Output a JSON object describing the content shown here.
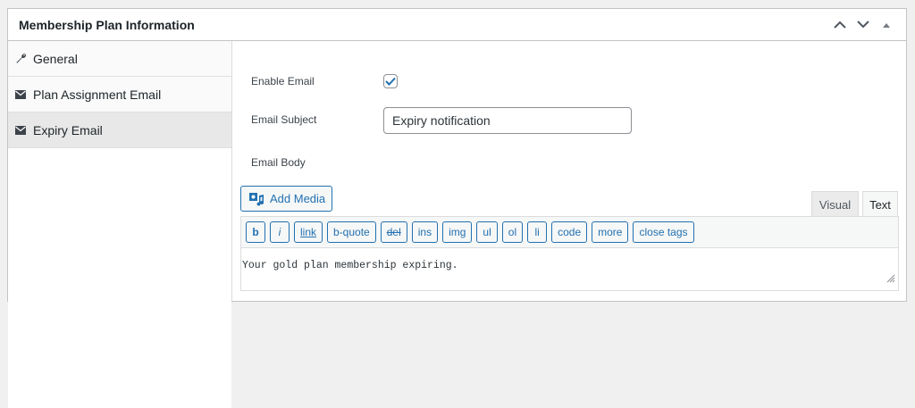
{
  "panel": {
    "title": "Membership Plan Information",
    "controls": [
      "chevron-up-icon",
      "chevron-down-icon",
      "triangle-up-icon"
    ]
  },
  "sidebar": {
    "items": [
      {
        "label": "General",
        "icon": "wrench-icon",
        "active": false
      },
      {
        "label": "Plan Assignment Email",
        "icon": "envelope-icon",
        "active": false
      },
      {
        "label": "Expiry Email",
        "icon": "envelope-icon",
        "active": true
      }
    ]
  },
  "form": {
    "enable_email_label": "Enable Email",
    "enable_email_checked": true,
    "email_subject_label": "Email Subject",
    "email_subject_value": "Expiry notification",
    "email_body_label": "Email Body"
  },
  "editor": {
    "add_media_label": "Add Media",
    "tabs": [
      {
        "label": "Visual",
        "active": false
      },
      {
        "label": "Text",
        "active": true
      }
    ],
    "toolbar": [
      "b",
      "i",
      "link",
      "b-quote",
      "del",
      "ins",
      "img",
      "ul",
      "ol",
      "li",
      "code",
      "more",
      "close tags"
    ],
    "content": "Your gold plan membership expiring."
  },
  "colors": {
    "accent": "#2271b1",
    "border": "#c3c4c7",
    "active_tab_bg": "#e8e8e8"
  }
}
